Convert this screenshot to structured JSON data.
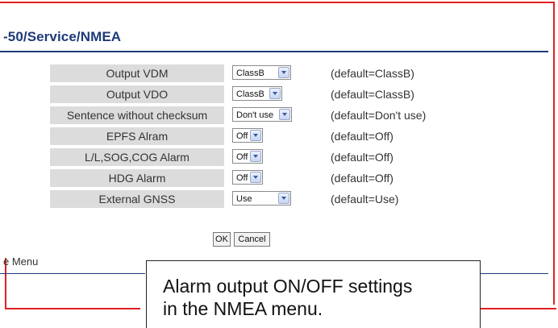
{
  "page": {
    "title": "-50/Service/NMEA",
    "menu_link": "e Menu"
  },
  "settings": [
    {
      "label": "Output VDM",
      "value": "ClassB",
      "default": "(default=ClassB)"
    },
    {
      "label": "Output VDO",
      "value": "ClassB",
      "default": "(default=ClassB)"
    },
    {
      "label": "Sentence without checksum",
      "value": "Don't use",
      "default": "(default=Don't use)"
    },
    {
      "label": "EPFS Alram",
      "value": "Off",
      "default": "(default=Off)"
    },
    {
      "label": "L/L,SOG,COG Alarm",
      "value": "Off",
      "default": "(default=Off)"
    },
    {
      "label": "HDG Alarm",
      "value": "Off",
      "default": "(default=Off)"
    },
    {
      "label": "External GNSS",
      "value": "Use",
      "default": "(default=Use)"
    }
  ],
  "buttons": {
    "ok": "OK",
    "cancel": "Cancel"
  },
  "callout": {
    "line1": "Alarm output ON/OFF settings",
    "line2": "in the NMEA menu."
  },
  "colors": {
    "title": "#1e3a78",
    "label_bg": "#dcdcdc",
    "frame_red": "#e02020"
  }
}
